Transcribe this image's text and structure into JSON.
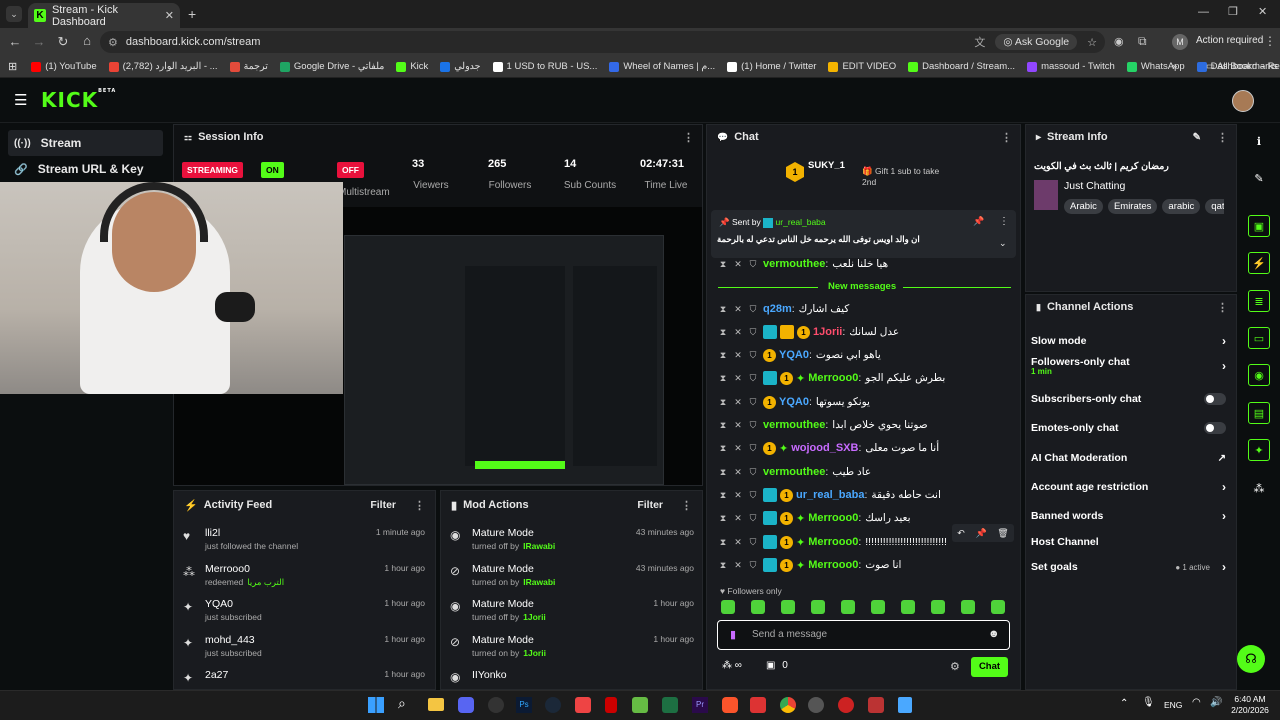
{
  "browser": {
    "tab_title": "Stream - Kick Dashboard",
    "url": "dashboard.kick.com/stream",
    "ask_google": "Ask Google",
    "profile_initial": "M",
    "action_required": "Action required",
    "bookmarks": [
      {
        "label": "(1) YouTube",
        "color": "#ff0000"
      },
      {
        "label": "(2,782) البريد الوارد - ...",
        "color": "#ea4335"
      },
      {
        "label": "ترجمة",
        "color": "#e34b3b"
      },
      {
        "label": "Google Drive - ملفاتي",
        "color": "#1fa463"
      },
      {
        "label": "Kick",
        "color": "#53fc18"
      },
      {
        "label": "جدولي",
        "color": "#1a73e8"
      },
      {
        "label": "1 USD to RUB - US...",
        "color": "#ffffff"
      },
      {
        "label": "Wheel of Names | م...",
        "color": "#3369e8"
      },
      {
        "label": "(1) Home / Twitter",
        "color": "#ffffff"
      },
      {
        "label": "EDIT VIDEO",
        "color": "#f4b400"
      },
      {
        "label": "Dashboard / Stream...",
        "color": "#53fc18"
      },
      {
        "label": "massoud - Twitch",
        "color": "#9146ff"
      },
      {
        "label": "WhatsApp",
        "color": "#25d366"
      },
      {
        "label": "Dashboard – Restre...",
        "color": "#2d6cdf"
      }
    ],
    "all_bookmarks": "All Bookmarks"
  },
  "kick": {
    "logo": "KICK",
    "beta": "BETA"
  },
  "sidebar": {
    "items": [
      {
        "label": "Stream",
        "icon": "stream-icon"
      },
      {
        "label": "Stream URL & Key",
        "icon": "link-icon"
      }
    ]
  },
  "session": {
    "title": "Session Info",
    "streaming": "STREAMING",
    "on": "ON",
    "off": "OFF",
    "multistream": "Multistream",
    "viewers": "33",
    "viewers_label": "Viewers",
    "followers": "265",
    "followers_label": "Followers",
    "subs": "14",
    "subs_label": "Sub Counts",
    "time": "02:47:31",
    "time_label": "Time Live"
  },
  "activity": {
    "title": "Activity Feed",
    "filter": "Filter",
    "items": [
      {
        "name": "lli2l",
        "sub": "just followed the channel",
        "time": "1 minute ago",
        "icon": "heart-icon"
      },
      {
        "name": "Merrooo0",
        "sub": "redeemed",
        "sub_extra": "الترب مريا",
        "time": "1 hour ago",
        "icon": "redeem-icon"
      },
      {
        "name": "YQA0",
        "sub": "just subscribed",
        "time": "1 hour ago",
        "icon": "star-icon"
      },
      {
        "name": "mohd_443",
        "sub": "just subscribed",
        "time": "1 hour ago",
        "icon": "star-icon"
      },
      {
        "name": "2a27",
        "sub": "",
        "time": "1 hour ago",
        "icon": "star-icon"
      }
    ]
  },
  "mod": {
    "title": "Mod Actions",
    "filter": "Filter",
    "items": [
      {
        "name": "Mature Mode",
        "sub": "turned off by",
        "by": "IRawabi",
        "time": "43 minutes ago"
      },
      {
        "name": "Mature Mode",
        "sub": "turned on by",
        "by": "IRawabi",
        "time": "43 minutes ago"
      },
      {
        "name": "Mature Mode",
        "sub": "turned off by",
        "by": "1Jorii",
        "time": "1 hour ago"
      },
      {
        "name": "Mature Mode",
        "sub": "turned on by",
        "by": "1Jorii",
        "time": "1 hour ago"
      },
      {
        "name": "IIYonko",
        "sub": "",
        "by": "",
        "time": ""
      }
    ]
  },
  "chat": {
    "title": "Chat",
    "gifter": "SUKY_1",
    "gifter_count": "1",
    "gift_text": "Gift 1 sub to take 2nd",
    "pinned_by_label": "Sent by",
    "pinned_user": "ur_real_baba",
    "pinned_text": "ان والد اويس توفى الله يرحمه خل الناس تدعي له بالرحمة",
    "new_messages": "New messages",
    "messages": [
      {
        "user": "vermouthee",
        "color": "#53fc18",
        "text": "هيا خلنا نلعب",
        "badges": "mod"
      },
      {
        "user": "q28m",
        "color": "#4aa8ff",
        "text": "كيف اشارك",
        "badges": "mod"
      },
      {
        "user": "1Jorii",
        "color": "#ff4d6d",
        "text": "عدل لسانك",
        "badges": "vip-crown-sub"
      },
      {
        "user": "YQA0",
        "color": "#4aa8ff",
        "text": "ياهو ابي نصوت",
        "badges": "sub"
      },
      {
        "user": "Merrooo0",
        "color": "#53fc18",
        "text": "بطرش عليكم الجو",
        "badges": "vip-sub-star"
      },
      {
        "user": "YQA0",
        "color": "#4aa8ff",
        "text": "يونكو يسوتها",
        "badges": "sub"
      },
      {
        "user": "vermouthee",
        "color": "#53fc18",
        "text": "صوتنا يحوي خلاص ابدا",
        "badges": "mod"
      },
      {
        "user": "wojood_SXB",
        "color": "#c86bff",
        "text": "أنا ما صوت معلى",
        "badges": "sub-star"
      },
      {
        "user": "vermouthee",
        "color": "#53fc18",
        "text": "عاد طيب",
        "badges": "mod"
      },
      {
        "user": "ur_real_baba",
        "color": "#4aa8ff",
        "text": "انت حاطه دقيقة",
        "badges": "vip-sub"
      },
      {
        "user": "Merrooo0",
        "color": "#53fc18",
        "text": "بعيد راسك",
        "badges": "vip-sub-star"
      },
      {
        "user": "Merrooo0",
        "color": "#53fc18",
        "text": "!!!!!!!!!!!!!!!!!!!!!!!!!!!!",
        "badges": "vip-sub-star"
      },
      {
        "user": "Merrooo0",
        "color": "#53fc18",
        "text": "انا صوت",
        "badges": "vip-sub-star"
      }
    ],
    "followers_only": "Followers only",
    "input_placeholder": "Send a message",
    "points": "0",
    "send": "Chat"
  },
  "stream_info": {
    "title": "Stream Info",
    "stream_title": "رمضان كريم | ثالث بث في الكويت",
    "category": "Just Chatting",
    "tags": [
      "Arabic",
      "Emirates",
      "arabic",
      "qat"
    ]
  },
  "channel_actions": {
    "title": "Channel Actions",
    "items": [
      {
        "label": "Slow mode",
        "kind": "arrow"
      },
      {
        "label": "Followers-only chat",
        "extra": "1 min",
        "kind": "arrow"
      },
      {
        "label": "Subscribers-only chat",
        "kind": "toggle"
      },
      {
        "label": "Emotes-only chat",
        "kind": "toggle"
      },
      {
        "label": "AI Chat Moderation",
        "kind": "external"
      },
      {
        "label": "Account age restriction",
        "kind": "arrow"
      },
      {
        "label": "Banned words",
        "kind": "arrow"
      },
      {
        "label": "Host Channel",
        "kind": "none"
      },
      {
        "label": "Set goals",
        "extra": "1 active",
        "kind": "arrow"
      }
    ]
  },
  "taskbar": {
    "lang": "ENG",
    "time": "6:40 AM",
    "date": "2/20/2026"
  },
  "colors": {
    "kick_green": "#53fc18",
    "panel": "#191b1f",
    "bg": "#0b0e0f",
    "streaming_red": "#e9113c"
  }
}
